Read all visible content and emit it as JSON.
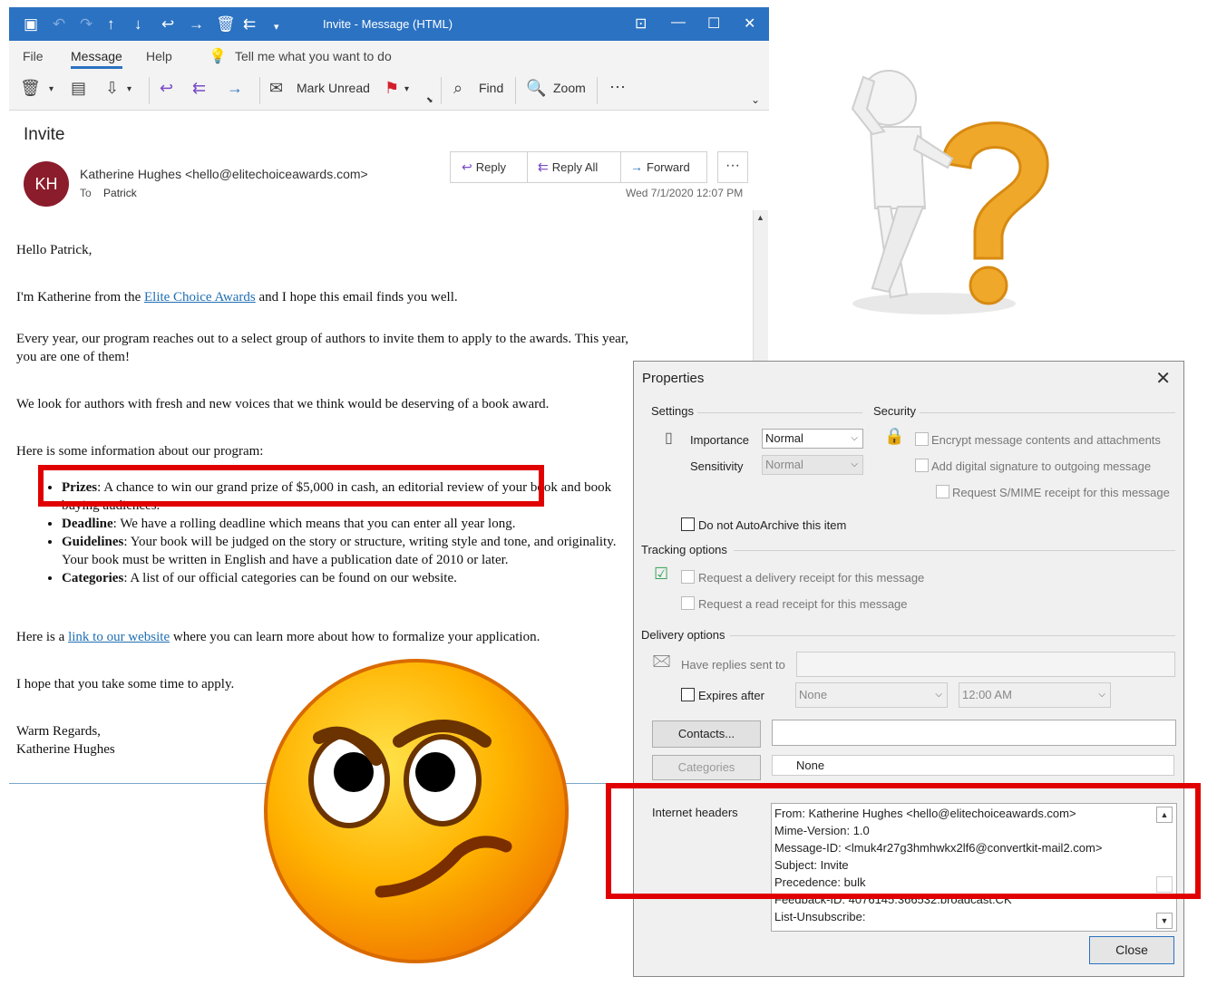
{
  "window": {
    "title": "Invite  -  Message (HTML)"
  },
  "menu": {
    "items": [
      "File",
      "Message",
      "Help"
    ],
    "tell_me": "Tell me what you want to do"
  },
  "ribbon": {
    "mark_unread": "Mark Unread",
    "find": "Find",
    "zoom": "Zoom",
    "more": "···"
  },
  "message": {
    "subject": "Invite",
    "avatar_initials": "KH",
    "avatar_color": "#8b1c2b",
    "sender": "Katherine Hughes <hello@elitechoiceawards.com>",
    "to_label": "To",
    "to_value": "Patrick",
    "date": "Wed 7/1/2020 12:07 PM",
    "actions": {
      "reply": "Reply",
      "reply_all": "Reply All",
      "forward": "Forward",
      "more": "···"
    }
  },
  "body": {
    "greeting": "Hello Patrick,",
    "intro_pre": "I'm Katherine from the ",
    "intro_link": "Elite Choice Awards",
    "intro_post": " and I hope this email finds you well.",
    "para1": "Every year, our program reaches out to a select group of authors to invite them to apply to the awards. This year, you are one of them!",
    "para2": "We look for authors with fresh and new voices that we think would be deserving of a book award.",
    "para3": "Here is some information about our program:",
    "bullets": [
      {
        "label": "Prizes",
        "text": ": A chance to win our grand prize of $5,000 in cash, an editorial review of your book and book buying audiences."
      },
      {
        "label": "Deadline",
        "text": ": We have a rolling deadline which means that you can enter all year long."
      },
      {
        "label": "Guidelines",
        "text": ": Your book will be judged on the story or structure, writing style and tone, and originality. Your book must be written in English and have a publication date of 2010 or later."
      },
      {
        "label": "Categories",
        "text": ": A list of our official categories can be found on our website."
      }
    ],
    "link_pre": "Here is a ",
    "link_text": "link to our website",
    "link_post": " where you can learn more about how to formalize your application.",
    "closing1": "I hope that you take some time to apply.",
    "signoff": "Warm Regards,",
    "signature": "Katherine Hughes"
  },
  "props": {
    "title": "Properties",
    "settings_label": "Settings",
    "security_label": "Security",
    "importance_label": "Importance",
    "importance_value": "Normal",
    "sensitivity_label": "Sensitivity",
    "sensitivity_value": "Normal",
    "encrypt": "Encrypt message contents and attachments",
    "signature": "Add digital signature to outgoing message",
    "smime": "Request S/MIME receipt for this message",
    "no_archive": "Do not AutoArchive this item",
    "tracking_label": "Tracking options",
    "delivery_receipt": "Request a delivery receipt for this message",
    "read_receipt": "Request a read receipt for this message",
    "delivery_label": "Delivery options",
    "replies_to": "Have replies sent to",
    "expires_after": "Expires after",
    "expires_date": "None",
    "expires_time": "12:00 AM",
    "contacts_btn": "Contacts...",
    "categories_btn": "Categories",
    "categories_value": "None",
    "headers_label": "Internet headers",
    "headers": [
      "From: Katherine Hughes <hello@elitechoiceawards.com>",
      "Mime-Version: 1.0",
      "Message-ID: <lmuk4r27g3hmhwkx2lf6@convertkit-mail2.com>",
      "Subject: Invite",
      "Precedence: bulk",
      "Feedback-ID: 4076145:366532.broadcast:CK",
      "List-Unsubscribe:"
    ],
    "close_btn": "Close"
  },
  "colors": {
    "titlebar": "#2b72c2",
    "highlight": "#e00000",
    "link": "#1f6fb4"
  }
}
